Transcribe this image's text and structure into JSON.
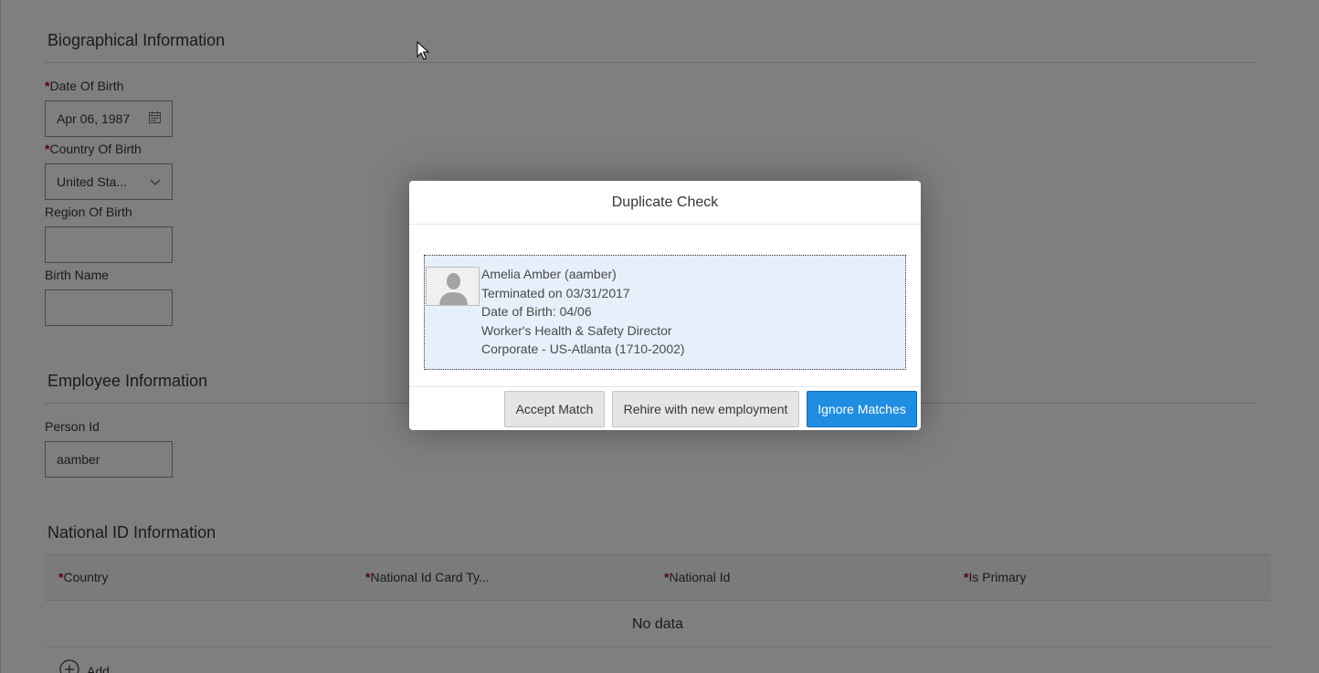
{
  "form": {
    "biographical": {
      "title": "Biographical Information",
      "date_of_birth_label": "Date Of Birth",
      "date_of_birth_value": "Apr 06, 1987",
      "country_of_birth_label": "Country Of Birth",
      "country_of_birth_value": "United Sta...",
      "region_of_birth_label": "Region Of Birth",
      "region_of_birth_value": "",
      "birth_name_label": "Birth Name",
      "birth_name_value": ""
    },
    "employee": {
      "title": "Employee Information",
      "person_id_label": "Person Id",
      "person_id_value": "aamber"
    },
    "national_id": {
      "title": "National ID Information",
      "columns": [
        "Country",
        "National Id Card Ty...",
        "National Id",
        "Is Primary"
      ],
      "no_data": "No data",
      "add_label": "Add"
    },
    "required_marker": "*"
  },
  "dialog": {
    "title": "Duplicate Check",
    "match": {
      "name": "Amelia Amber (aamber)",
      "status": "Terminated on 03/31/2017",
      "date_of_birth": "Date of Birth: 04/06",
      "job_title": "Worker's Health & Safety Director",
      "location": "Corporate - US-Atlanta (1710-2002)"
    },
    "buttons": {
      "accept": "Accept Match",
      "rehire": "Rehire with new employment",
      "ignore": "Ignore Matches"
    }
  },
  "colors": {
    "primary_button": "#1f8de2",
    "required": "#bb0000",
    "match_card_bg": "#e5f0fa"
  }
}
